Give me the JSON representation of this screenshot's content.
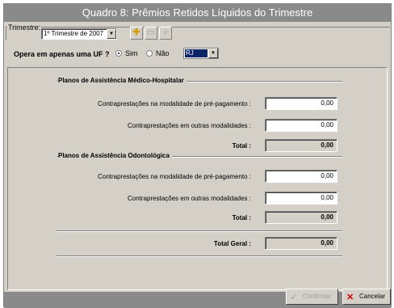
{
  "window": {
    "title": "Quadro 8: Prêmios Retidos Líquidos do Trimestre"
  },
  "toolbar": {
    "trimestre_label": "Trimestre:",
    "trimestre_value": "1º Trimestre de 2007",
    "uf_question": "Opera em apenas uma UF ?",
    "sim_label": "Sim",
    "nao_label": "Não",
    "uf_value": "RJ",
    "icons": {
      "add": "add-icon",
      "remove": "remove-icon",
      "search": "search-icon",
      "dropdown": "chevron-down-icon"
    }
  },
  "medico": {
    "title": "Planos de Assistência Médico-Hospitalar",
    "pre_label": "Contraprestações na modalidade de pré-pagamento :",
    "pre_value": "0,00",
    "outras_label": "Contraprestações em outras modalidades :",
    "outras_value": "0,00",
    "total_label": "Total :",
    "total_value": "0,00"
  },
  "odonto": {
    "title": "Planos de Assistência Odontológica",
    "pre_label": "Contraprestações na modalidade de pré-pagamento :",
    "pre_value": "0,00",
    "outras_label": "Contraprestações em outras modalidades :",
    "outras_value": "0,00",
    "total_label": "Total :",
    "total_value": "0,00"
  },
  "geral": {
    "label": "Total Geral :",
    "value": "0,00"
  },
  "footer": {
    "confirm_label": "Confirmar",
    "cancel_label": "Cancelar",
    "icons": {
      "confirm": "check-icon",
      "cancel": "close-icon"
    }
  }
}
